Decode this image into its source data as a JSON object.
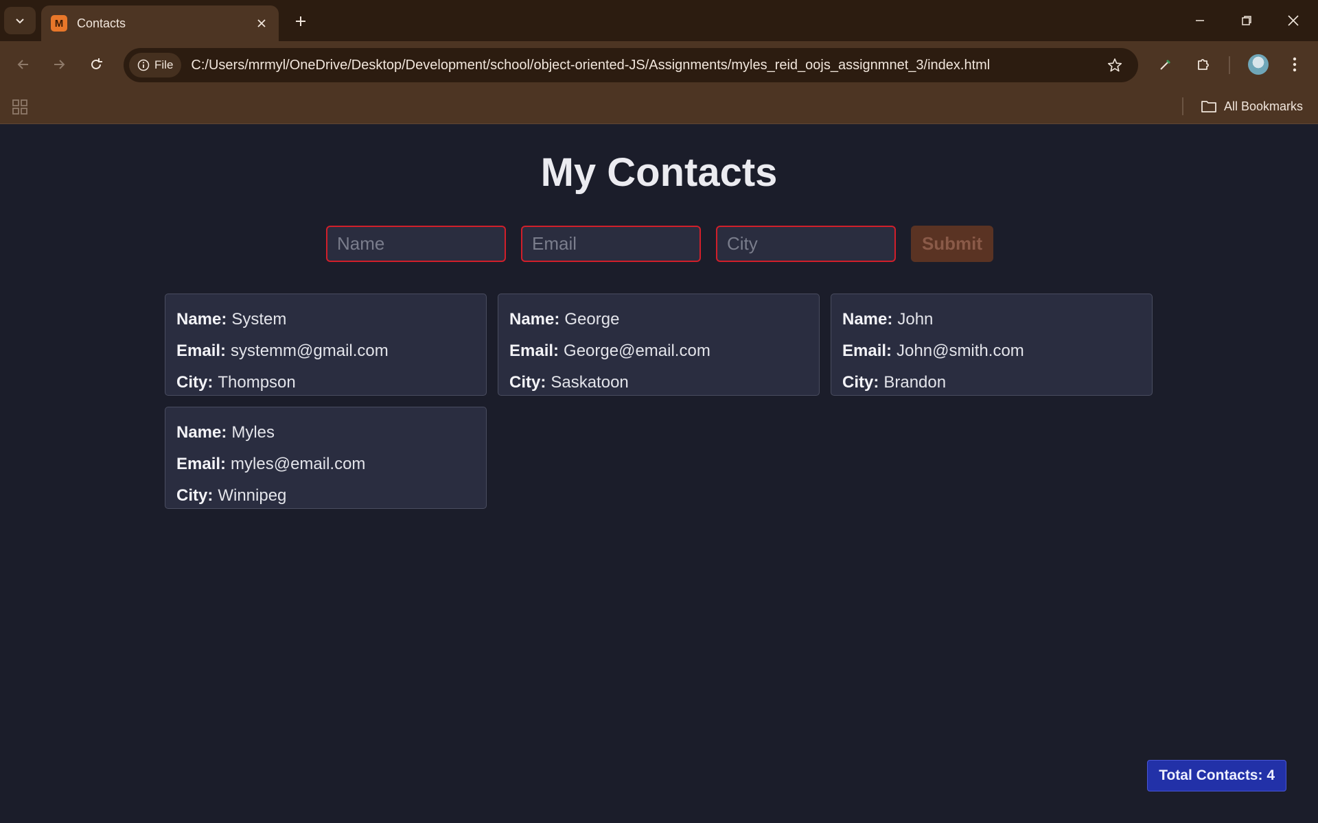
{
  "browser": {
    "tab_title": "Contacts",
    "favicon_letter": "M",
    "site_chip": "File",
    "url": "C:/Users/mrmyl/OneDrive/Desktop/Development/school/object-oriented-JS/Assignments/myles_reid_oojs_assignmnet_3/index.html",
    "bookmarks_label": "All Bookmarks"
  },
  "page": {
    "title": "My Contacts",
    "form": {
      "name_placeholder": "Name",
      "email_placeholder": "Email",
      "city_placeholder": "City",
      "submit_label": "Submit"
    },
    "labels": {
      "name": "Name:",
      "email": "Email:",
      "city": "City:"
    },
    "contacts": [
      {
        "name": "System",
        "email": "systemm@gmail.com",
        "city": "Thompson"
      },
      {
        "name": "George",
        "email": "George@email.com",
        "city": "Saskatoon"
      },
      {
        "name": "John",
        "email": "John@smith.com",
        "city": "Brandon"
      },
      {
        "name": "Myles",
        "email": "myles@email.com",
        "city": "Winnipeg"
      }
    ],
    "total_label": "Total Contacts: 4"
  },
  "colors": {
    "page_bg": "#1b1d2a",
    "input_border": "#d21f2a",
    "badge_bg": "#2231a8"
  }
}
